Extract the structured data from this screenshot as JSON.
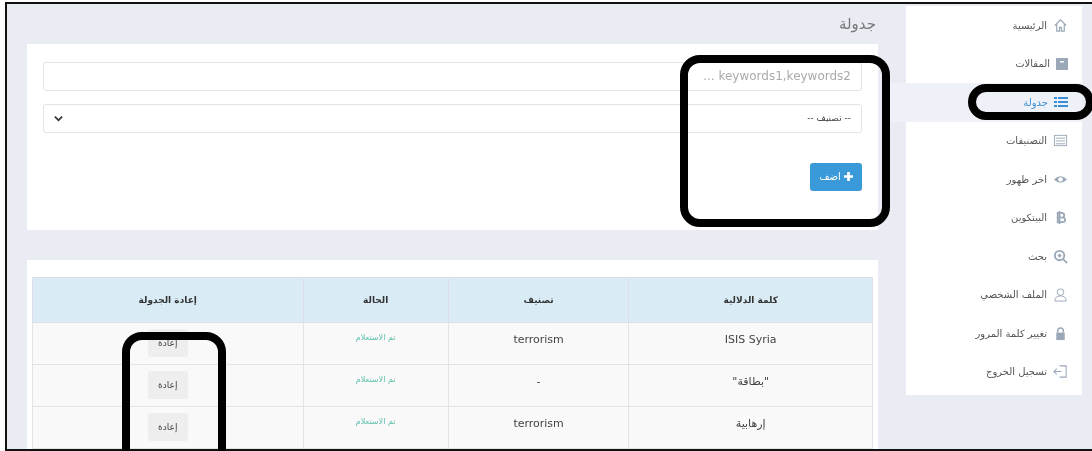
{
  "page_title": "جدولة",
  "sidebar": {
    "items": [
      {
        "label": "الرئيسية",
        "kind": "home",
        "selected": false
      },
      {
        "label": "المقالات",
        "kind": "archive",
        "selected": false
      },
      {
        "label": "جدولة",
        "kind": "list",
        "selected": true
      },
      {
        "label": "التصنيفات",
        "kind": "table",
        "selected": false
      },
      {
        "label": "اخر ظهور",
        "kind": "eye",
        "selected": false
      },
      {
        "label": "البيتكوين",
        "kind": "bitcoin",
        "selected": false
      },
      {
        "label": "بحث",
        "kind": "zoom",
        "selected": false
      },
      {
        "label": "الملف الشخصي",
        "kind": "user",
        "selected": false
      },
      {
        "label": "تغيير كلمة المرور",
        "kind": "lock",
        "selected": false
      },
      {
        "label": "تسجيل الخروج",
        "kind": "logout",
        "selected": false
      }
    ]
  },
  "form": {
    "keywords": {
      "placeholder": "keywords1,keywords2 ..."
    },
    "category": {
      "value": "-- تصنيف --"
    },
    "add_button": "اضف"
  },
  "table": {
    "columns": [
      "كلمة الدلالية",
      "تصنيف",
      "الحالة",
      "إعادة الجدولة"
    ],
    "rows": [
      {
        "keyword": "ISIS Syria",
        "category": "terrorism",
        "status": "تم الاستعلام",
        "action": "إعادة"
      },
      {
        "keyword": "\"بطاقة\"",
        "category": "-",
        "status": "تم الاستعلام",
        "action": "إعادة"
      },
      {
        "keyword": "إرهابية",
        "category": "terrorism",
        "status": "تم الاستعلام",
        "action": "إعادة"
      }
    ]
  }
}
